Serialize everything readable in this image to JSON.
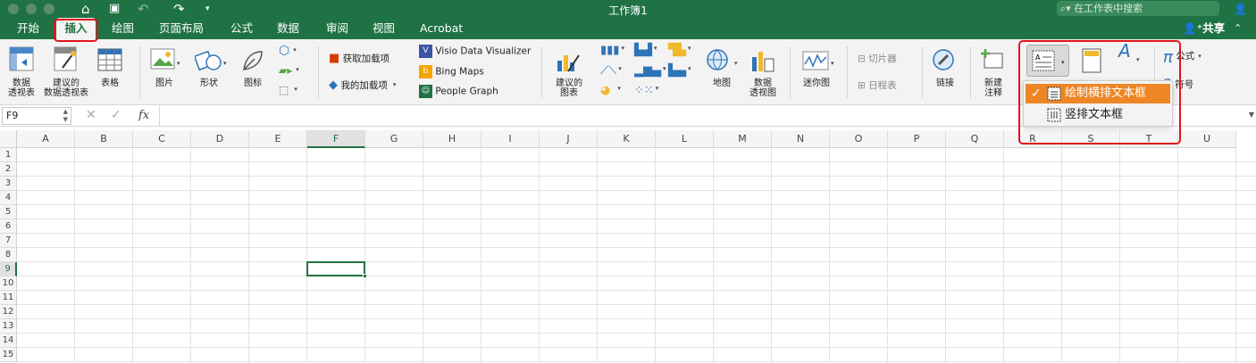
{
  "window": {
    "title": "工作簿1",
    "search_placeholder": "在工作表中搜索",
    "share_label": "共享"
  },
  "tabs": [
    "开始",
    "插入",
    "绘图",
    "页面布局",
    "公式",
    "数据",
    "审阅",
    "视图",
    "Acrobat"
  ],
  "ribbon": {
    "pivot": "数据\n透视表",
    "rec_pivot": "建议的\n数据透视表",
    "table": "表格",
    "pictures": "图片",
    "shapes": "形状",
    "icons": "图标",
    "get_addins": "获取加载项",
    "my_addins": "我的加载项",
    "visio": "Visio Data Visualizer",
    "bing": "Bing Maps",
    "people": "People Graph",
    "rec_charts": "建议的\n图表",
    "maps": "地图",
    "pivot_chart": "数据\n透视图",
    "sparklines": "迷你图",
    "slicer": "切片器",
    "timeline": "日程表",
    "link": "链接",
    "new_comment": "新建\n注释",
    "equation": "公式",
    "symbol": "符号"
  },
  "namebox": "F9",
  "fx": "fx",
  "columns": [
    "A",
    "B",
    "C",
    "D",
    "E",
    "F",
    "G",
    "H",
    "I",
    "J",
    "K",
    "L",
    "M",
    "N",
    "O",
    "P",
    "Q",
    "R",
    "S",
    "T",
    "U"
  ],
  "rows": [
    "1",
    "2",
    "3",
    "4",
    "5",
    "6",
    "7",
    "8",
    "9",
    "10",
    "11",
    "12",
    "13",
    "14",
    "15"
  ],
  "selected_cell": "F9",
  "textbox_menu": {
    "horizontal": "绘制横排文本框",
    "vertical": "竖排文本框",
    "checkmark": "✓"
  },
  "colors": {
    "brand": "#1f7244",
    "highlight": "#ee8626",
    "annotation": "#e0141e"
  }
}
